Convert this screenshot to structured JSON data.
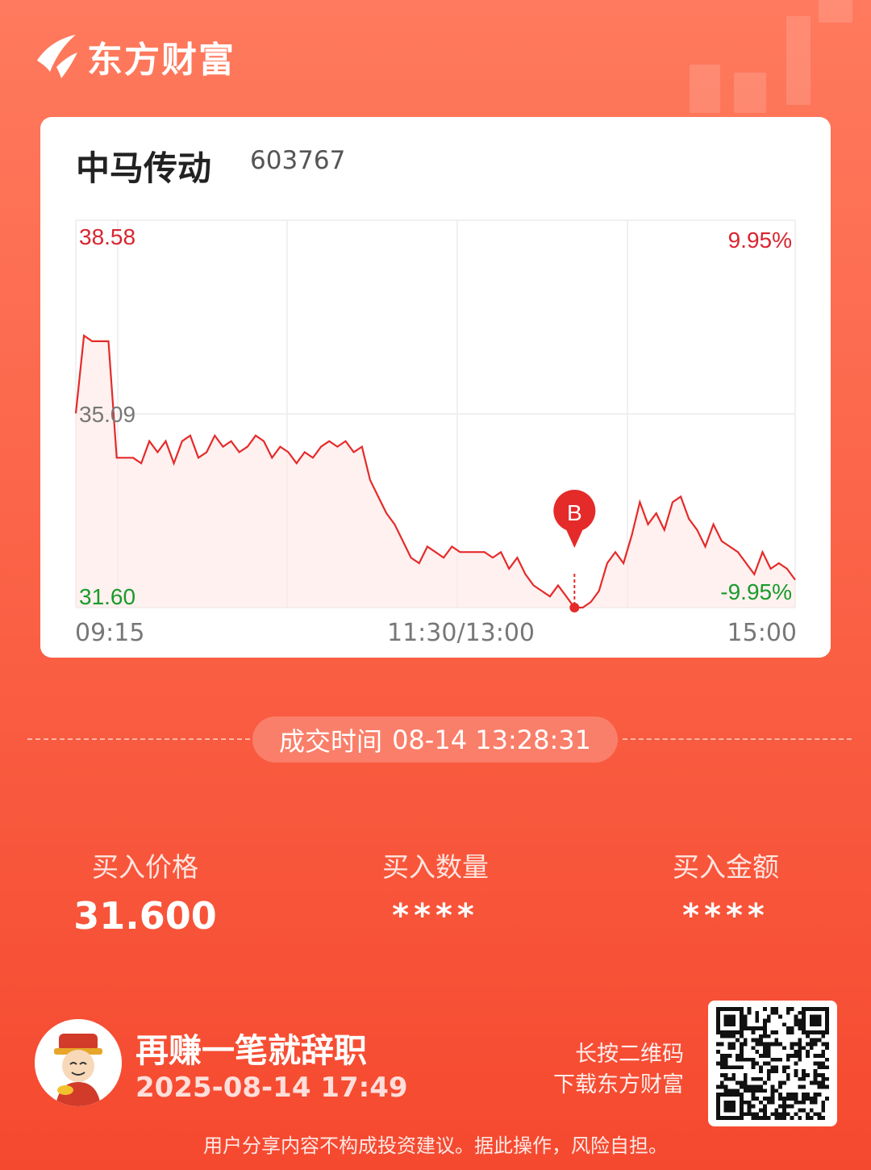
{
  "brand": {
    "name": "东方财富",
    "icon": "east-money-logo-icon"
  },
  "stock": {
    "name": "中马传动",
    "code": "603767"
  },
  "chart_data": {
    "type": "line",
    "title": "",
    "price_axis": {
      "max": "38.58",
      "mid": "35.09",
      "min": "31.60"
    },
    "pct_axis": {
      "max": "9.95%",
      "min": "-9.95%"
    },
    "ylim": [
      31.6,
      38.58
    ],
    "x_ticks": [
      "09:15",
      "11:30/13:00",
      "15:00"
    ],
    "series": [
      {
        "values": [
          35.1,
          36.5,
          36.4,
          36.4,
          36.4,
          34.3,
          34.3,
          34.3,
          34.2,
          34.6,
          34.4,
          34.6,
          34.2,
          34.6,
          34.7,
          34.3,
          34.4,
          34.7,
          34.5,
          34.6,
          34.4,
          34.5,
          34.7,
          34.6,
          34.3,
          34.5,
          34.4,
          34.2,
          34.4,
          34.3,
          34.5,
          34.6,
          34.5,
          34.6,
          34.4,
          34.5,
          33.9,
          33.6,
          33.3,
          33.1,
          32.8,
          32.5,
          32.4,
          32.7,
          32.6,
          32.5,
          32.7,
          32.6,
          32.6,
          32.6,
          32.6,
          32.5,
          32.6,
          32.3,
          32.5,
          32.2,
          32.0,
          31.9,
          31.8,
          32.0,
          31.8,
          31.6,
          31.6,
          31.7,
          31.9,
          32.4,
          32.6,
          32.4,
          32.9,
          33.5,
          33.1,
          33.3,
          33.0,
          33.5,
          33.6,
          33.2,
          33.0,
          32.7,
          33.1,
          32.8,
          32.7,
          32.6,
          32.4,
          32.2,
          32.6,
          32.3,
          32.4,
          32.3,
          32.1
        ],
        "buy_marker": {
          "label": "B",
          "value": 31.6,
          "time": "13:28"
        }
      }
    ],
    "grid": true
  },
  "trade_time": {
    "label": "成交时间",
    "value": "08-14 13:28:31"
  },
  "stats": [
    {
      "label": "买入价格",
      "value": "31.600"
    },
    {
      "label": "买入数量",
      "value": "****"
    },
    {
      "label": "买入金额",
      "value": "****"
    }
  ],
  "footer": {
    "avatar_icon": "caishen-avatar-icon",
    "slogan": "再赚一笔就辞职",
    "date": "2025-08-14 17:49",
    "qr_hint_line1": "长按二维码",
    "qr_hint_line2": "下载东方财富",
    "qr_icon": "qr-code-icon",
    "disclaimer": "用户分享内容不构成投资建议。据此操作，风险自担。"
  },
  "colors": {
    "up_red": "#d9252f",
    "down_green": "#1a9a2b",
    "chart_line": "#e52a2a",
    "background": "#f5492f"
  }
}
